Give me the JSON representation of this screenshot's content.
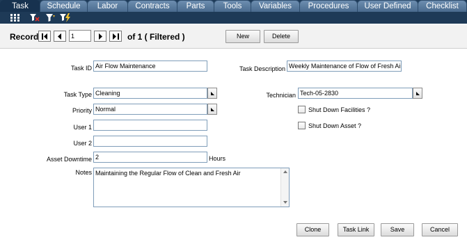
{
  "tabs": [
    {
      "label": "Task",
      "active": true
    },
    {
      "label": "Schedule"
    },
    {
      "label": "Labor"
    },
    {
      "label": "Contracts"
    },
    {
      "label": "Parts"
    },
    {
      "label": "Tools"
    },
    {
      "label": "Variables"
    },
    {
      "label": "Procedures"
    },
    {
      "label": "User Defined"
    },
    {
      "label": "Checklist"
    }
  ],
  "toolbar": {
    "icons": [
      "grid-icon",
      "clear-filter-icon",
      "filter-icon",
      "quick-filter-icon"
    ]
  },
  "record": {
    "label": "Record:",
    "current": "1",
    "of_text": "of 1 ( Filtered )",
    "new_label": "New",
    "delete_label": "Delete"
  },
  "form": {
    "task_id": {
      "label": "Task ID",
      "value": "Air Flow Maintenance"
    },
    "task_description": {
      "label": "Task Description",
      "value": "Weekly Maintenance of Flow of Fresh Air"
    },
    "task_type": {
      "label": "Task Type",
      "value": "Cleaning"
    },
    "technician": {
      "label": "Technician",
      "value": "Tech-05-2830"
    },
    "priority": {
      "label": "Priority",
      "value": "Normal"
    },
    "shut_down_facilities": {
      "label": "Shut Down Facilities ?",
      "checked": false
    },
    "shut_down_asset": {
      "label": "Shut Down Asset ?",
      "checked": false
    },
    "user1": {
      "label": "User 1",
      "value": ""
    },
    "user2": {
      "label": "User 2",
      "value": ""
    },
    "asset_downtime": {
      "label": "Asset Downtime",
      "value": "2",
      "unit": "Hours"
    },
    "notes": {
      "label": "Notes",
      "value": "Maintaining the Regular Flow of Clean and Fresh Air"
    }
  },
  "actions": {
    "clone": "Clone",
    "task_link": "Task Link",
    "save": "Save",
    "cancel": "Cancel"
  },
  "colors": {
    "tab_bar": "#1e3a57",
    "tab": "#4a6b8e",
    "tab_active": "#17324f",
    "field_border": "#7f9db9"
  }
}
